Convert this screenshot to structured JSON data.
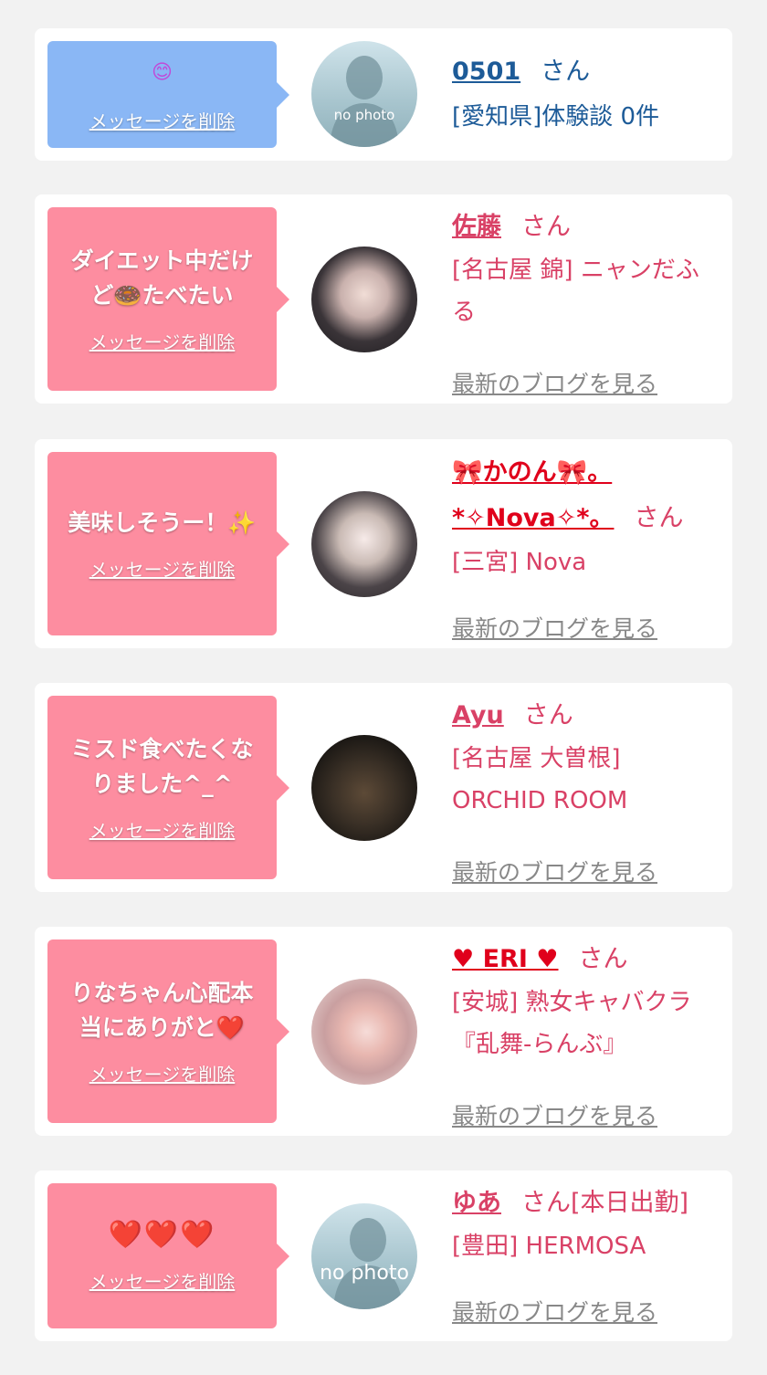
{
  "delete_label": "メッセージを削除",
  "san": "さん",
  "blog_label": "最新のブログを見る",
  "no_photo": "no photo",
  "messages": [
    {
      "message": "😊",
      "name": "0501",
      "shop": "[愛知県]体験談 0件"
    },
    {
      "message": "ダイエット中だけど🍩たべたい",
      "name": "佐藤",
      "shop": "[名古屋 錦] ニャンだふる"
    },
    {
      "message": "美味しそうー！✨",
      "name": "🎀かのん🎀。*✧Nova✧*。",
      "shop": "[三宮] Nova"
    },
    {
      "message": "ミスド食べたくなりました^_^",
      "name": "Ayu",
      "shop": "[名古屋 大曽根] ORCHID ROOM"
    },
    {
      "message": "りなちゃん心配本当にありがと❤️",
      "name": "♥ ERI ♥",
      "shop": "[安城] 熟女キャバクラ『乱舞-らんぶ』"
    },
    {
      "message": "❤️❤️❤️",
      "name": "ゆあ",
      "status": "[本日出勤]",
      "shop": "[豊田] HERMOSA"
    }
  ],
  "colors": {
    "bubble_blue": "#8ab7f5",
    "bubble_pink": "#fd8da0",
    "name_blue": "#1d5b98",
    "name_pink": "#d94166",
    "name_red": "#e0001b"
  }
}
